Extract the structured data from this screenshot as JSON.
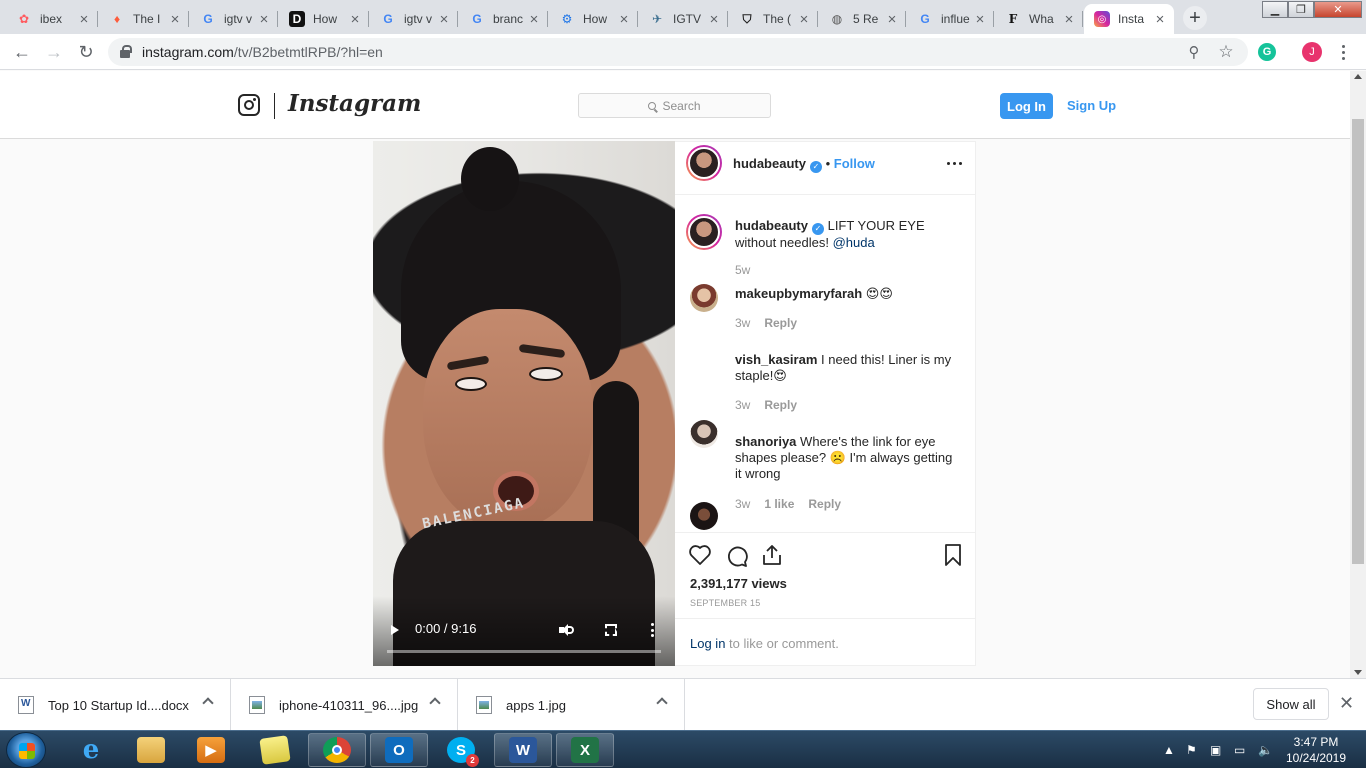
{
  "browser": {
    "tabs": [
      {
        "title": "ibex",
        "icon": "airbnb-icon",
        "active": false
      },
      {
        "title": "The I",
        "icon": "tinder-icon",
        "active": false
      },
      {
        "title": "igtv v",
        "icon": "google-icon",
        "active": false
      },
      {
        "title": "How",
        "icon": "d-icon",
        "active": false
      },
      {
        "title": "igtv v",
        "icon": "google-icon",
        "active": false
      },
      {
        "title": "branc",
        "icon": "google-icon",
        "active": false
      },
      {
        "title": "How",
        "icon": "gear-icon",
        "active": false
      },
      {
        "title": "IGTV",
        "icon": "igtv-icon",
        "active": false
      },
      {
        "title": "The (",
        "icon": "shield-icon",
        "active": false
      },
      {
        "title": "5 Re",
        "icon": "globe-icon",
        "active": false
      },
      {
        "title": "influe",
        "icon": "google-icon",
        "active": false
      },
      {
        "title": "Wha",
        "icon": "forbes-icon",
        "active": false
      },
      {
        "title": "Insta",
        "icon": "instagram-icon",
        "active": true
      }
    ],
    "url_host": "instagram.com",
    "url_path": "/tv/B2betmtlRPB/?hl=en",
    "profile_initial": "J",
    "grammarly_letter": "G"
  },
  "instagram": {
    "wordmark": "Instagram",
    "search_placeholder": "Search",
    "login_label": "Log In",
    "signup_label": "Sign Up",
    "post": {
      "owner": "hudabeauty",
      "follow_label": "Follow",
      "caption_user": "hudabeauty",
      "caption_text": "LIFT YOUR EYE without needles!",
      "caption_mention": "@huda",
      "caption_age": "5w",
      "comments": [
        {
          "user": "makeupbymaryfarah",
          "text": "😍😍",
          "age": "3w",
          "likes": "",
          "reply": "Reply"
        },
        {
          "user": "vish_kasiram",
          "text": "I need this! Liner is my staple!😍",
          "age": "3w",
          "likes": "",
          "reply": "Reply"
        },
        {
          "user": "shanoriya",
          "text": "Where's the link for eye shapes please? ☹️ I'm always getting it wrong",
          "age": "3w",
          "likes": "1 like",
          "reply": "Reply"
        }
      ],
      "views": "2,391,177 views",
      "date": "SEPTEMBER 15",
      "login_link": "Log in",
      "login_rest": " to like or comment."
    },
    "video": {
      "time": "0:00 / 9:16",
      "choker_text": "BALENCIAGA"
    }
  },
  "downloads": {
    "items": [
      {
        "name": "Top 10 Startup Id....docx",
        "type": "word"
      },
      {
        "name": "iphone-410311_96....jpg",
        "type": "img"
      },
      {
        "name": "apps 1.jpg",
        "type": "img"
      }
    ],
    "show_all": "Show all"
  },
  "taskbar": {
    "time": "3:47 PM",
    "date": "10/24/2019",
    "apps": [
      "internet-explorer",
      "file-explorer",
      "media-player",
      "sticky-notes",
      "chrome",
      "outlook",
      "skype",
      "word",
      "excel"
    ],
    "skype_badge": "2"
  }
}
